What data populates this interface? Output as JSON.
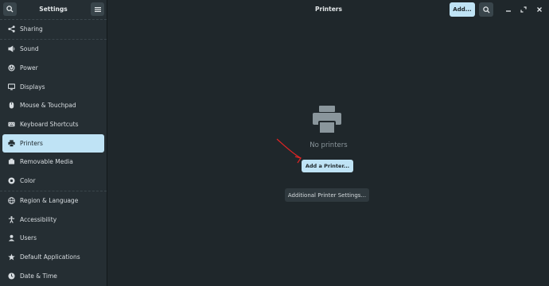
{
  "sidebar": {
    "title": "Settings",
    "search_icon": "search-icon",
    "menu_icon": "hamburger-menu-icon",
    "items": [
      {
        "label": "Sharing",
        "icon": "share-icon"
      },
      {
        "label": "Sound",
        "icon": "speaker-icon"
      },
      {
        "label": "Power",
        "icon": "power-icon"
      },
      {
        "label": "Displays",
        "icon": "display-icon"
      },
      {
        "label": "Mouse & Touchpad",
        "icon": "mouse-icon"
      },
      {
        "label": "Keyboard Shortcuts",
        "icon": "keyboard-icon"
      },
      {
        "label": "Printers",
        "icon": "printer-icon",
        "active": true
      },
      {
        "label": "Removable Media",
        "icon": "media-icon"
      },
      {
        "label": "Color",
        "icon": "color-icon"
      },
      {
        "label": "Region & Language",
        "icon": "globe-icon"
      },
      {
        "label": "Accessibility",
        "icon": "accessibility-icon"
      },
      {
        "label": "Users",
        "icon": "users-icon"
      },
      {
        "label": "Default Applications",
        "icon": "star-icon"
      },
      {
        "label": "Date & Time",
        "icon": "clock-icon"
      }
    ]
  },
  "header": {
    "title": "Printers",
    "add_label": "Add...",
    "search_icon": "search-icon",
    "window_controls": [
      "minimize-icon",
      "restore-icon",
      "close-icon"
    ]
  },
  "main": {
    "empty_icon": "printer-icon",
    "empty_text": "No printers",
    "add_printer_label": "Add a Printer...",
    "additional_settings_label": "Additional Printer Settings..."
  },
  "colors": {
    "accent": "#bfe3f5",
    "sidebar_bg": "#252e33",
    "main_bg": "#1f272b",
    "annotation_arrow": "#e02424"
  }
}
